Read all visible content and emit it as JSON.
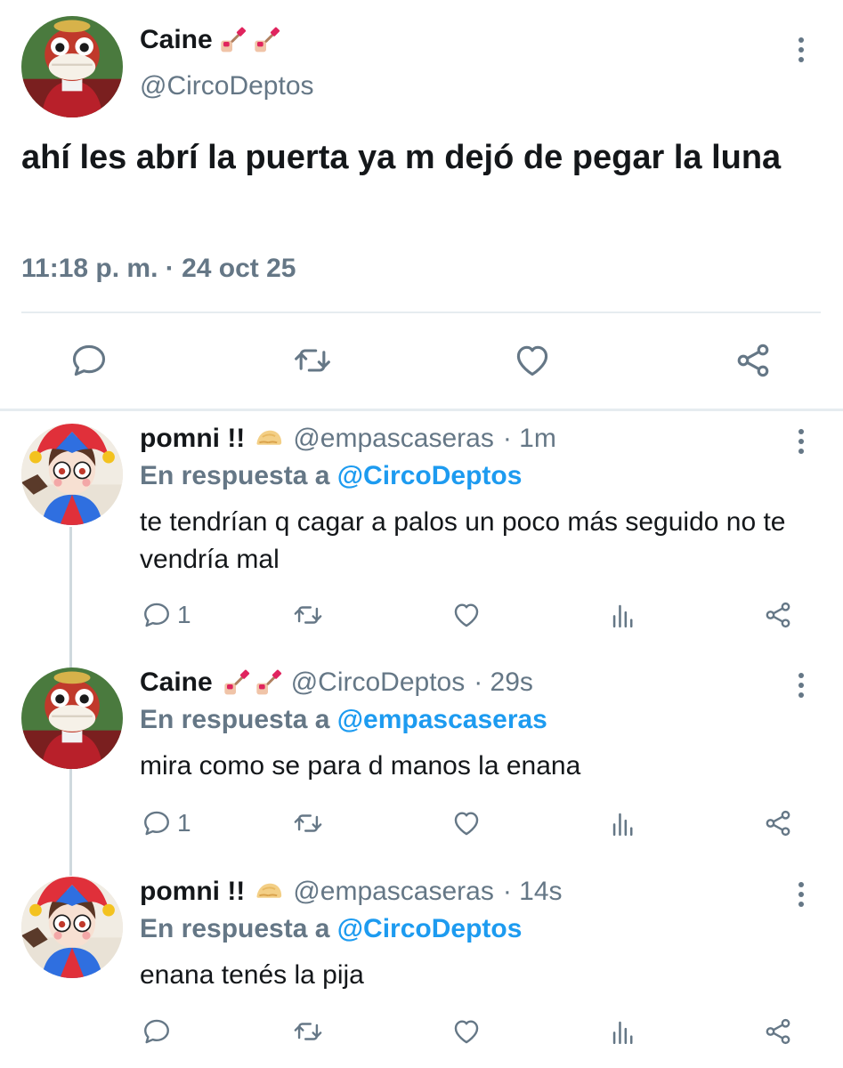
{
  "main_tweet": {
    "author_name": "Caine",
    "author_handle": "@CircoDeptos",
    "text": "ahí les abrí la puerta ya m dejó de pegar la luna",
    "timestamp": "11:18 p. m. · 24 oct 25",
    "emoji": [
      "nail-polish-icon",
      "nail-polish-icon"
    ],
    "actions": [
      "reply-icon",
      "retweet-icon",
      "like-icon",
      "share-icon"
    ]
  },
  "replies": [
    {
      "author_name": "pomni !!",
      "author_handle": "@empascaseras",
      "time": "· 1m",
      "in_reply_prefix": "En respuesta a",
      "in_reply_to": "@CircoDeptos",
      "text": "te tendrían q cagar a palos un poco más seguido no te vendría mal",
      "reply_count": "1"
    },
    {
      "author_name": "Caine",
      "author_handle": "@CircoDeptos",
      "time": "· 29s",
      "in_reply_prefix": "En respuesta a",
      "in_reply_to": "@empascaseras",
      "text": "mira como se para d manos la enana",
      "reply_count": "1"
    },
    {
      "author_name": "pomni !!",
      "author_handle": "@empascaseras",
      "time": "· 14s",
      "in_reply_prefix": "En respuesta a",
      "in_reply_to": "@CircoDeptos",
      "text": "enana tenés la pija",
      "reply_count": ""
    }
  ],
  "colors": {
    "text": "#14171a",
    "secondary": "#657786",
    "link": "#1d9bf0",
    "divider": "#e6ecf0"
  }
}
